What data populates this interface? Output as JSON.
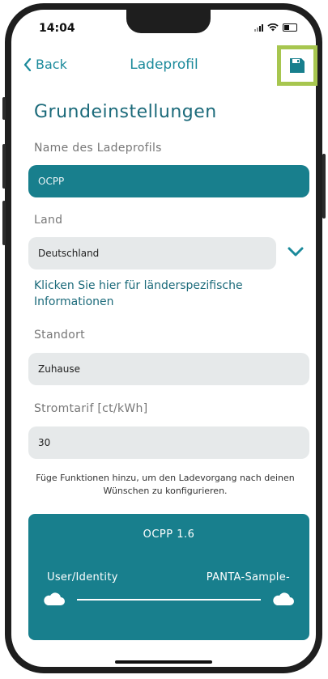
{
  "status_bar": {
    "time": "14:04"
  },
  "nav": {
    "back_label": "Back",
    "title": "Ladeprofil"
  },
  "section_title": "Grundeinstellungen",
  "profile_name": {
    "label": "Name des Ladeprofils",
    "value": "OCPP"
  },
  "country": {
    "label": "Land",
    "value": "Deutschland"
  },
  "country_info_link": "Klicken Sie hier für länderspezifische Informationen",
  "location": {
    "label": "Standort",
    "value": "Zuhause"
  },
  "tariff": {
    "label": "Stromtarif [ct/kWh]",
    "value": "30"
  },
  "hint": "Füge Funktionen hinzu, um den Ladevorgang nach deinen Wünschen zu konfigurieren.",
  "ocpp_card": {
    "title": "OCPP 1.6",
    "left_label": "User/Identity",
    "right_label": "PANTA-Sample-"
  },
  "colors": {
    "accent": "#187f8d",
    "link": "#1b6a7a",
    "highlight": "#a7c64f"
  }
}
